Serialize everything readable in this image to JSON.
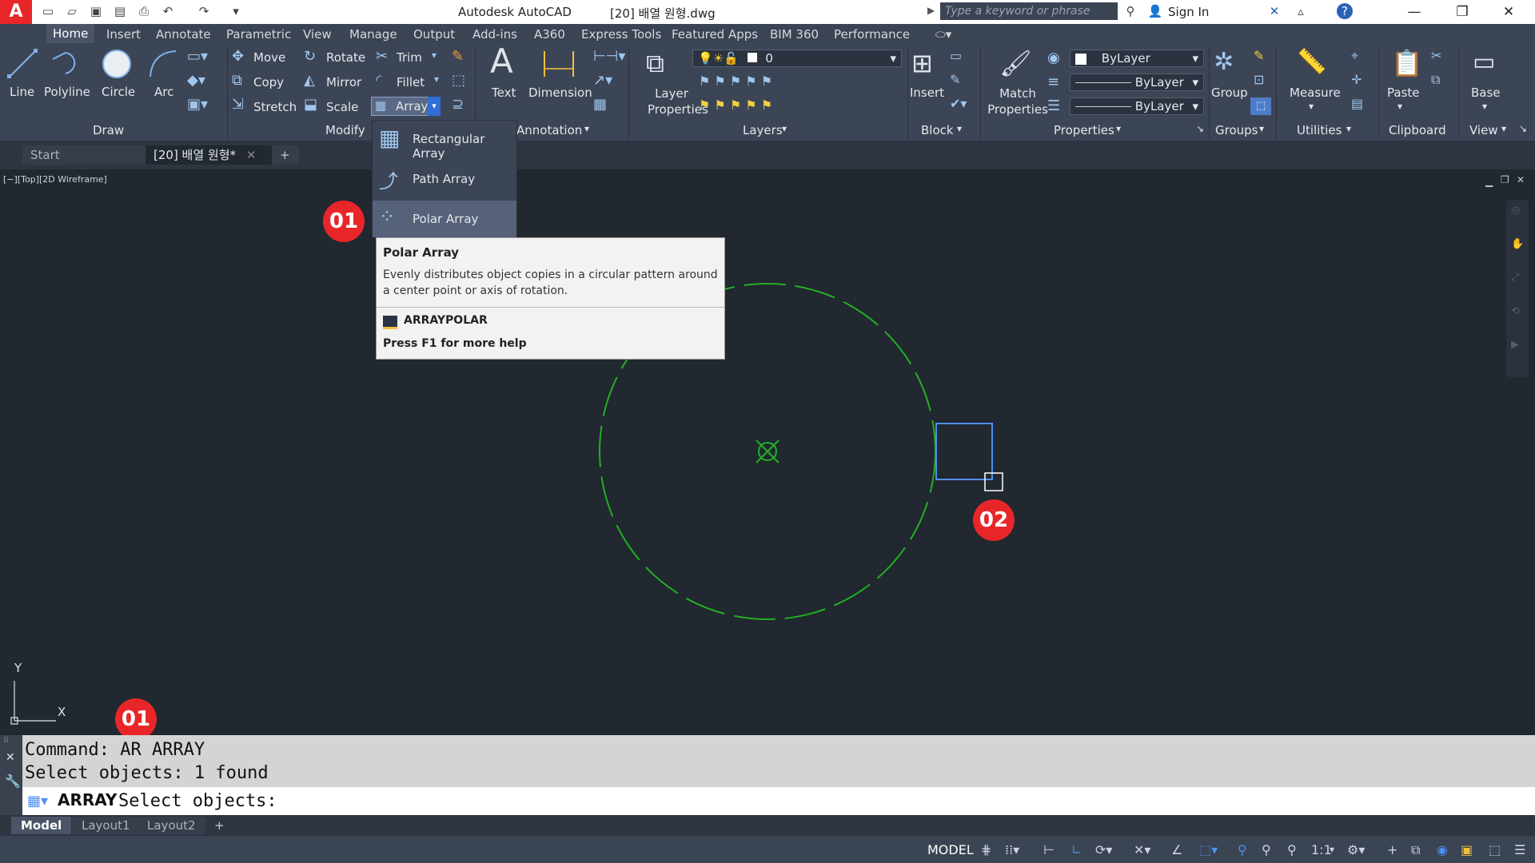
{
  "app": {
    "title": "Autodesk AutoCAD",
    "file": "[20] 배열 원형.dwg"
  },
  "search": {
    "placeholder": "Type a keyword or phrase"
  },
  "signin": "Sign In",
  "ribbon_tabs": [
    "Home",
    "Insert",
    "Annotate",
    "Parametric",
    "View",
    "Manage",
    "Output",
    "Add-ins",
    "A360",
    "Express Tools",
    "Featured Apps",
    "BIM 360",
    "Performance"
  ],
  "draw": {
    "line": "Line",
    "polyline": "Polyline",
    "circle": "Circle",
    "arc": "Arc",
    "title": "Draw"
  },
  "modify": {
    "move": "Move",
    "rotate": "Rotate",
    "trim": "Trim",
    "copy": "Copy",
    "mirror": "Mirror",
    "fillet": "Fillet",
    "stretch": "Stretch",
    "scale": "Scale",
    "array": "Array",
    "title": "Modify"
  },
  "annotation": {
    "text": "Text",
    "dimension": "Dimension",
    "title": "Annotation"
  },
  "layers": {
    "layer_properties": "Layer Properties",
    "current_layer": "0",
    "title": "Layers"
  },
  "block": {
    "insert": "Insert",
    "title": "Block"
  },
  "properties": {
    "match": "Match Properties",
    "color": "ByLayer",
    "linetype": "ByLayer",
    "lineweight": "ByLayer",
    "title": "Properties"
  },
  "groups": {
    "group": "Group",
    "title": "Groups"
  },
  "utilities": {
    "measure": "Measure",
    "title": "Utilities"
  },
  "clipboard": {
    "paste": "Paste",
    "title": "Clipboard"
  },
  "view": {
    "base": "Base",
    "title": "View"
  },
  "doc_tabs": {
    "start": "Start",
    "current": "[20] 배열 원형*"
  },
  "viewport_label": "[−][Top][2D Wireframe]",
  "array_menu": {
    "items": [
      "Rectangular Array",
      "Path Array",
      "Polar Array"
    ]
  },
  "tooltip": {
    "title": "Polar Array",
    "desc": "Evenly distributes object copies in a circular pattern around a center point or axis of rotation.",
    "command": "ARRAYPOLAR",
    "help": "Press F1 for more help"
  },
  "badges": {
    "b1": "01",
    "b2": "02",
    "b3": "01"
  },
  "ucs": {
    "x": "X",
    "y": "Y"
  },
  "command": {
    "line1": "Command: AR ARRAY",
    "line2": "Select objects: 1 found",
    "prompt_cmd": "ARRAY",
    "prompt_text": "Select objects:"
  },
  "layout_tabs": [
    "Model",
    "Layout1",
    "Layout2"
  ],
  "status": {
    "model": "MODEL",
    "scale": "1:1"
  },
  "colors": {
    "accent": "#e8262a",
    "drawing": "#22b022",
    "selection": "#4e8ff0"
  }
}
